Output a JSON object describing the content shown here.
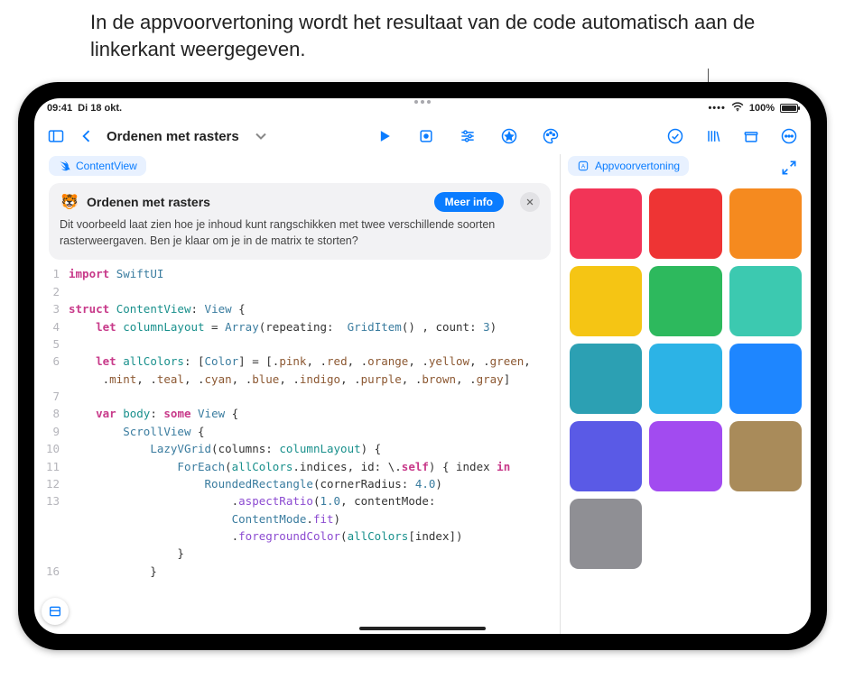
{
  "annotation": "In de appvoorvertoning wordt het resultaat van de code automatisch aan de linkerkant weergegeven.",
  "status": {
    "time": "09:41",
    "date": "Di 18 okt.",
    "battery_pct": "100%"
  },
  "toolbar": {
    "doc_title": "Ordenen met rasters"
  },
  "left": {
    "tab_label": "ContentView",
    "info": {
      "title": "Ordenen met rasters",
      "more_label": "Meer info",
      "body": "Dit voorbeeld laat zien hoe je inhoud kunt rangschikken met twee verschillende soorten rasterweergaven. Ben je klaar om je in de matrix te storten?"
    }
  },
  "right": {
    "header_label": "Appvoorvertoning"
  },
  "code_lines": [
    {
      "n": "1",
      "seg": [
        [
          "kw-pink",
          "import"
        ],
        [
          "",
          " "
        ],
        [
          "typ",
          "SwiftUI"
        ]
      ]
    },
    {
      "n": "2",
      "seg": [
        [
          "",
          ""
        ]
      ]
    },
    {
      "n": "3",
      "seg": [
        [
          "kw-pink",
          "struct"
        ],
        [
          "",
          " "
        ],
        [
          "ident-teal",
          "ContentView"
        ],
        [
          "",
          ": "
        ],
        [
          "typ",
          "View"
        ],
        [
          "",
          " {"
        ]
      ]
    },
    {
      "n": "4",
      "seg": [
        [
          "",
          "    "
        ],
        [
          "kw-pink",
          "let"
        ],
        [
          "",
          " "
        ],
        [
          "ident-teal",
          "columnLayout"
        ],
        [
          "",
          " = "
        ],
        [
          "typ",
          "Array"
        ],
        [
          "",
          "(repeating:  "
        ],
        [
          "typ",
          "GridItem"
        ],
        [
          "",
          "() , count: "
        ],
        [
          "num",
          "3"
        ],
        [
          "",
          ")"
        ]
      ]
    },
    {
      "n": "5",
      "seg": [
        [
          "",
          ""
        ]
      ]
    },
    {
      "n": "6",
      "seg": [
        [
          "",
          "    "
        ],
        [
          "kw-pink",
          "let"
        ],
        [
          "",
          " "
        ],
        [
          "ident-teal",
          "allColors"
        ],
        [
          "",
          ": ["
        ],
        [
          "typ",
          "Color"
        ],
        [
          "",
          "] = [."
        ],
        [
          "dot-name",
          "pink"
        ],
        [
          "",
          ", ."
        ],
        [
          "dot-name",
          "red"
        ],
        [
          "",
          ", ."
        ],
        [
          "dot-name",
          "orange"
        ],
        [
          "",
          ", ."
        ],
        [
          "dot-name",
          "yellow"
        ],
        [
          "",
          ", ."
        ],
        [
          "dot-name",
          "green"
        ],
        [
          "",
          ","
        ]
      ]
    },
    {
      "n": "",
      "seg": [
        [
          "",
          "     ."
        ],
        [
          "dot-name",
          "mint"
        ],
        [
          "",
          ", ."
        ],
        [
          "dot-name",
          "teal"
        ],
        [
          "",
          ", ."
        ],
        [
          "dot-name",
          "cyan"
        ],
        [
          "",
          ", ."
        ],
        [
          "dot-name",
          "blue"
        ],
        [
          "",
          ", ."
        ],
        [
          "dot-name",
          "indigo"
        ],
        [
          "",
          ", ."
        ],
        [
          "dot-name",
          "purple"
        ],
        [
          "",
          ", ."
        ],
        [
          "dot-name",
          "brown"
        ],
        [
          "",
          ", ."
        ],
        [
          "dot-name",
          "gray"
        ],
        [
          "",
          "]"
        ]
      ]
    },
    {
      "n": "7",
      "seg": [
        [
          "",
          ""
        ]
      ]
    },
    {
      "n": "8",
      "seg": [
        [
          "",
          "    "
        ],
        [
          "kw-pink",
          "var"
        ],
        [
          "",
          " "
        ],
        [
          "ident-teal",
          "body"
        ],
        [
          "",
          ": "
        ],
        [
          "kw-pink",
          "some"
        ],
        [
          "",
          " "
        ],
        [
          "typ",
          "View"
        ],
        [
          "",
          " {"
        ]
      ]
    },
    {
      "n": "9",
      "seg": [
        [
          "",
          "        "
        ],
        [
          "typ",
          "ScrollView"
        ],
        [
          "",
          " {"
        ]
      ]
    },
    {
      "n": "10",
      "seg": [
        [
          "",
          "            "
        ],
        [
          "typ",
          "LazyVGrid"
        ],
        [
          "",
          "(columns: "
        ],
        [
          "ident-teal",
          "columnLayout"
        ],
        [
          "",
          ") {"
        ]
      ]
    },
    {
      "n": "11",
      "seg": [
        [
          "",
          "                "
        ],
        [
          "typ",
          "ForEach"
        ],
        [
          "",
          "("
        ],
        [
          "ident-teal",
          "allColors"
        ],
        [
          "",
          ".indices, id: \\."
        ],
        [
          "kw-pink",
          "self"
        ],
        [
          "",
          ") { index "
        ],
        [
          "kw-pink",
          "in"
        ]
      ]
    },
    {
      "n": "12",
      "seg": [
        [
          "",
          "                    "
        ],
        [
          "typ",
          "RoundedRectangle"
        ],
        [
          "",
          "(cornerRadius: "
        ],
        [
          "num",
          "4.0"
        ],
        [
          "",
          ")"
        ]
      ]
    },
    {
      "n": "13",
      "seg": [
        [
          "",
          "                        ."
        ],
        [
          "prop",
          "aspectRatio"
        ],
        [
          "",
          "("
        ],
        [
          "num",
          "1.0"
        ],
        [
          "",
          ", contentMode:"
        ]
      ]
    },
    {
      "n": "",
      "seg": [
        [
          "",
          "                        "
        ],
        [
          "typ",
          "ContentMode"
        ],
        [
          "",
          "."
        ],
        [
          "prop",
          "fit"
        ],
        [
          "",
          ")"
        ]
      ]
    },
    {
      "n": "",
      "seg": [
        [
          "",
          "                        ."
        ],
        [
          "prop",
          "foregroundColor"
        ],
        [
          "",
          "("
        ],
        [
          "ident-teal",
          "allColors"
        ],
        [
          "",
          "[index])"
        ]
      ]
    },
    {
      "n": "",
      "seg": [
        [
          "",
          "                }"
        ]
      ]
    },
    {
      "n": "16",
      "seg": [
        [
          "",
          "            }"
        ]
      ]
    }
  ],
  "swatches": [
    "#f23457",
    "#ee3434",
    "#f58a1f",
    "#f5c514",
    "#2db95d",
    "#3cc9b0",
    "#2ca0b3",
    "#2cb3e6",
    "#1e86ff",
    "#5a5ae6",
    "#a24bf0",
    "#a98b5a",
    "#8f8f94"
  ]
}
